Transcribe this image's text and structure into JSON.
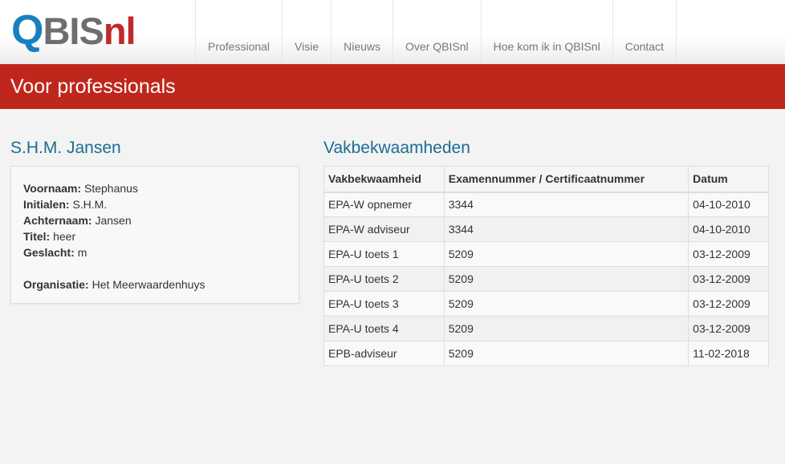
{
  "logo": {
    "q": "Q",
    "bi": "BIS",
    "nl": "nl"
  },
  "nav": [
    "Professional",
    "Visie",
    "Nieuws",
    "Over QBISnl",
    "Hoe kom ik in QBISnl",
    "Contact"
  ],
  "banner": {
    "title": "Voor professionals"
  },
  "person": {
    "name": "S.H.M. Jansen",
    "fields": [
      {
        "label": "Voornaam:",
        "value": "Stephanus"
      },
      {
        "label": "Initialen:",
        "value": "S.H.M."
      },
      {
        "label": "Achternaam:",
        "value": "Jansen"
      },
      {
        "label": "Titel:",
        "value": "heer"
      },
      {
        "label": "Geslacht:",
        "value": "m"
      }
    ],
    "organisation": {
      "label": "Organisatie:",
      "value": "Het Meerwaardenhuys"
    }
  },
  "skills": {
    "title": "Vakbekwaamheden",
    "headers": [
      "Vakbekwaamheid",
      "Examennummer / Certificaatnummer",
      "Datum"
    ],
    "rows": [
      [
        "EPA-W opnemer",
        "3344",
        "04-10-2010"
      ],
      [
        "EPA-W adviseur",
        "3344",
        "04-10-2010"
      ],
      [
        "EPA-U toets 1",
        "5209",
        "03-12-2009"
      ],
      [
        "EPA-U toets 2",
        "5209",
        "03-12-2009"
      ],
      [
        "EPA-U toets 3",
        "5209",
        "03-12-2009"
      ],
      [
        "EPA-U toets 4",
        "5209",
        "03-12-2009"
      ],
      [
        "EPB-adviseur",
        "5209",
        "11-02-2018"
      ]
    ]
  }
}
